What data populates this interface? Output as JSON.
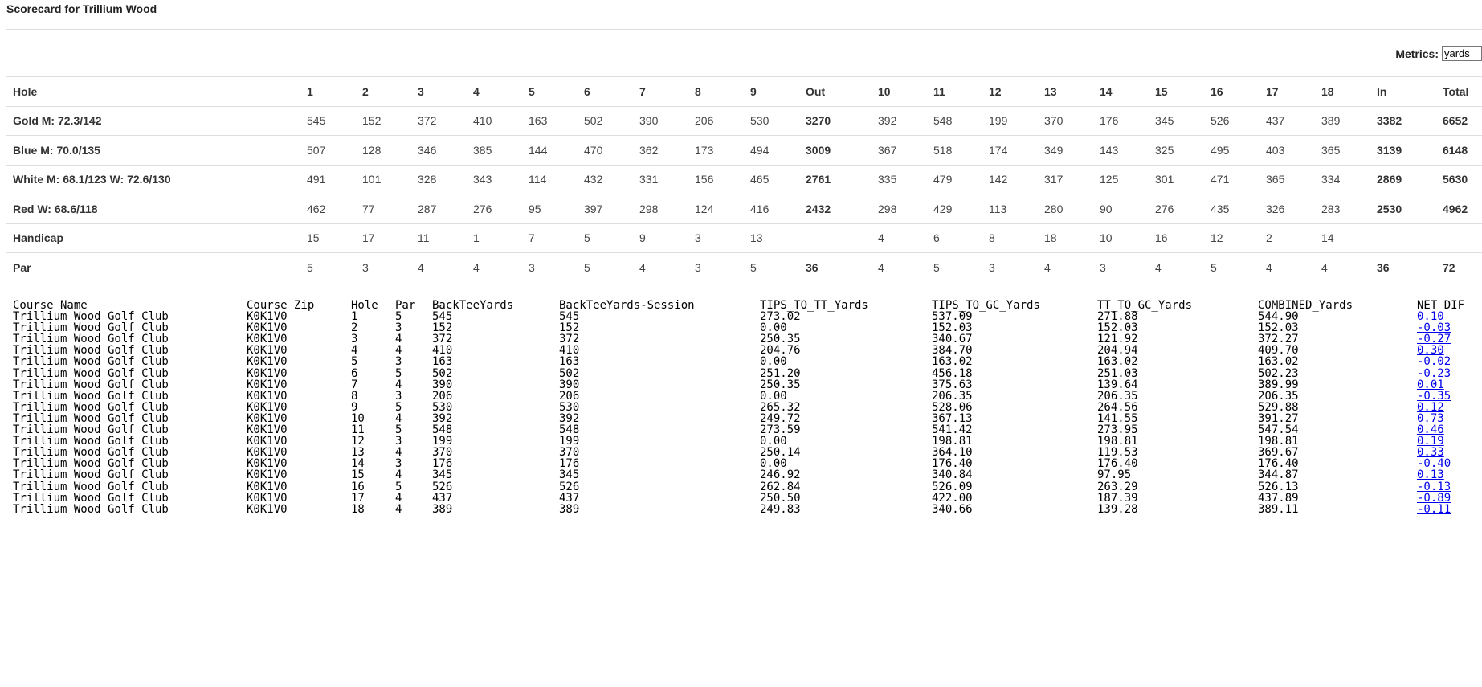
{
  "page_title": "Scorecard for Trillium Wood",
  "metrics": {
    "label": "Metrics:",
    "selected": "yards"
  },
  "scorecard": {
    "headers": [
      "Hole",
      "1",
      "2",
      "3",
      "4",
      "5",
      "6",
      "7",
      "8",
      "9",
      "Out",
      "10",
      "11",
      "12",
      "13",
      "14",
      "15",
      "16",
      "17",
      "18",
      "In",
      "Total"
    ],
    "rows": [
      {
        "label": "Gold M: 72.3/142",
        "cells": [
          "545",
          "152",
          "372",
          "410",
          "163",
          "502",
          "390",
          "206",
          "530",
          "3270",
          "392",
          "548",
          "199",
          "370",
          "176",
          "345",
          "526",
          "437",
          "389",
          "3382",
          "6652"
        ]
      },
      {
        "label": "Blue M: 70.0/135",
        "cells": [
          "507",
          "128",
          "346",
          "385",
          "144",
          "470",
          "362",
          "173",
          "494",
          "3009",
          "367",
          "518",
          "174",
          "349",
          "143",
          "325",
          "495",
          "403",
          "365",
          "3139",
          "6148"
        ]
      },
      {
        "label": "White M: 68.1/123 W: 72.6/130",
        "cells": [
          "491",
          "101",
          "328",
          "343",
          "114",
          "432",
          "331",
          "156",
          "465",
          "2761",
          "335",
          "479",
          "142",
          "317",
          "125",
          "301",
          "471",
          "365",
          "334",
          "2869",
          "5630"
        ]
      },
      {
        "label": "Red W: 68.6/118",
        "cells": [
          "462",
          "77",
          "287",
          "276",
          "95",
          "397",
          "298",
          "124",
          "416",
          "2432",
          "298",
          "429",
          "113",
          "280",
          "90",
          "276",
          "435",
          "326",
          "283",
          "2530",
          "4962"
        ]
      },
      {
        "label": "Handicap",
        "cells": [
          "15",
          "17",
          "11",
          "1",
          "7",
          "5",
          "9",
          "3",
          "13",
          "",
          "4",
          "6",
          "8",
          "18",
          "10",
          "16",
          "12",
          "2",
          "14",
          "",
          ""
        ]
      },
      {
        "label": "Par",
        "cells": [
          "5",
          "3",
          "4",
          "4",
          "3",
          "5",
          "4",
          "3",
          "5",
          "36",
          "4",
          "5",
          "3",
          "4",
          "3",
          "4",
          "5",
          "4",
          "4",
          "36",
          "72"
        ]
      }
    ]
  },
  "data_dump": {
    "headers": [
      "Course Name",
      "Course Zip",
      "Hole",
      "Par",
      "BackTeeYards",
      "BackTeeYards-Session",
      "TIPS_TO_TT_Yards",
      "TIPS_TO_GC_Yards",
      "TT_TO_GC_Yards",
      "COMBINED_Yards",
      "NET DIF"
    ],
    "rows": [
      [
        "Trillium Wood Golf Club",
        "K0K1V0",
        "1",
        "5",
        "545",
        "545",
        "273.02",
        "537.09",
        "271.88",
        "544.90",
        "0.10"
      ],
      [
        "Trillium Wood Golf Club",
        "K0K1V0",
        "2",
        "3",
        "152",
        "152",
        "0.00",
        "152.03",
        "152.03",
        "152.03",
        "-0.03"
      ],
      [
        "Trillium Wood Golf Club",
        "K0K1V0",
        "3",
        "4",
        "372",
        "372",
        "250.35",
        "340.67",
        "121.92",
        "372.27",
        "-0.27"
      ],
      [
        "Trillium Wood Golf Club",
        "K0K1V0",
        "4",
        "4",
        "410",
        "410",
        "204.76",
        "384.70",
        "204.94",
        "409.70",
        "0.30"
      ],
      [
        "Trillium Wood Golf Club",
        "K0K1V0",
        "5",
        "3",
        "163",
        "163",
        "0.00",
        "163.02",
        "163.02",
        "163.02",
        "-0.02"
      ],
      [
        "Trillium Wood Golf Club",
        "K0K1V0",
        "6",
        "5",
        "502",
        "502",
        "251.20",
        "456.18",
        "251.03",
        "502.23",
        "-0.23"
      ],
      [
        "Trillium Wood Golf Club",
        "K0K1V0",
        "7",
        "4",
        "390",
        "390",
        "250.35",
        "375.63",
        "139.64",
        "389.99",
        "0.01"
      ],
      [
        "Trillium Wood Golf Club",
        "K0K1V0",
        "8",
        "3",
        "206",
        "206",
        "0.00",
        "206.35",
        "206.35",
        "206.35",
        "-0.35"
      ],
      [
        "Trillium Wood Golf Club",
        "K0K1V0",
        "9",
        "5",
        "530",
        "530",
        "265.32",
        "528.06",
        "264.56",
        "529.88",
        "0.12"
      ],
      [
        "Trillium Wood Golf Club",
        "K0K1V0",
        "10",
        "4",
        "392",
        "392",
        "249.72",
        "367.13",
        "141.55",
        "391.27",
        "0.73"
      ],
      [
        "Trillium Wood Golf Club",
        "K0K1V0",
        "11",
        "5",
        "548",
        "548",
        "273.59",
        "541.42",
        "273.95",
        "547.54",
        "0.46"
      ],
      [
        "Trillium Wood Golf Club",
        "K0K1V0",
        "12",
        "3",
        "199",
        "199",
        "0.00",
        "198.81",
        "198.81",
        "198.81",
        "0.19"
      ],
      [
        "Trillium Wood Golf Club",
        "K0K1V0",
        "13",
        "4",
        "370",
        "370",
        "250.14",
        "364.10",
        "119.53",
        "369.67",
        "0.33"
      ],
      [
        "Trillium Wood Golf Club",
        "K0K1V0",
        "14",
        "3",
        "176",
        "176",
        "0.00",
        "176.40",
        "176.40",
        "176.40",
        "-0.40"
      ],
      [
        "Trillium Wood Golf Club",
        "K0K1V0",
        "15",
        "4",
        "345",
        "345",
        "246.92",
        "340.84",
        "97.95",
        "344.87",
        "0.13"
      ],
      [
        "Trillium Wood Golf Club",
        "K0K1V0",
        "16",
        "5",
        "526",
        "526",
        "262.84",
        "526.09",
        "263.29",
        "526.13",
        "-0.13"
      ],
      [
        "Trillium Wood Golf Club",
        "K0K1V0",
        "17",
        "4",
        "437",
        "437",
        "250.50",
        "422.00",
        "187.39",
        "437.89",
        "-0.89"
      ],
      [
        "Trillium Wood Golf Club",
        "K0K1V0",
        "18",
        "4",
        "389",
        "389",
        "249.83",
        "340.66",
        "139.28",
        "389.11",
        "-0.11"
      ]
    ]
  }
}
